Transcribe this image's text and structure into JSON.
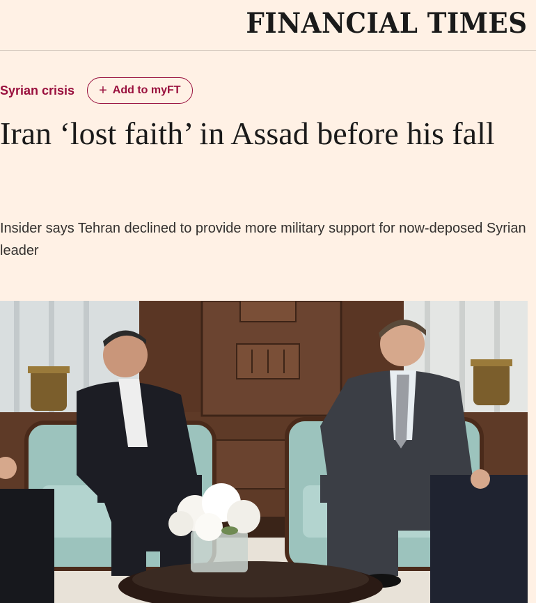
{
  "masthead": {
    "title": "FINANCIAL TIMES"
  },
  "topic": {
    "label": "Syrian crisis",
    "add_label": "Add to myFT"
  },
  "article": {
    "headline": "Iran ‘lost faith’ in Assad before his fall",
    "standfirst": "Insider says Tehran declined to provide more military support for now-deposed Syrian leader"
  },
  "icons": {
    "add": "plus-icon"
  },
  "colors": {
    "background": "#fff1e5",
    "accent": "#990f3d",
    "text": "#1a1a1a"
  }
}
